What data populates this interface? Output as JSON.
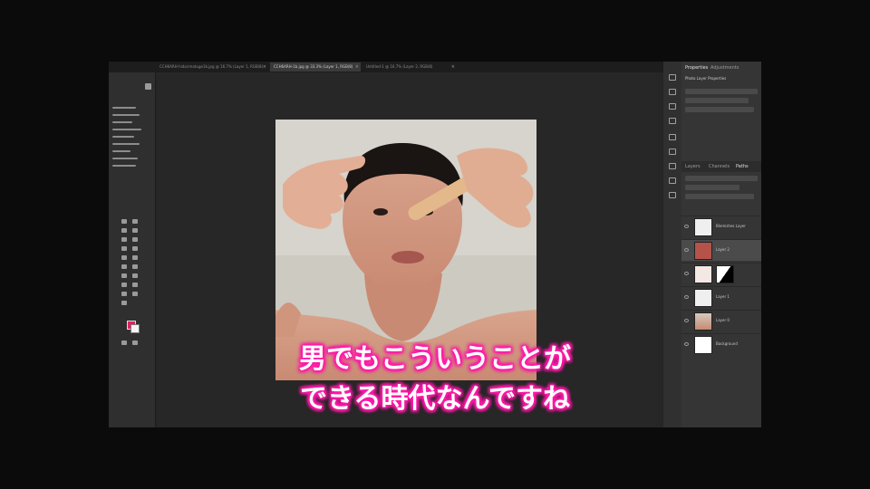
{
  "tabs": [
    {
      "label": "CCH6ARH-hidarimatuge1b.jpg @ 16.7% (Layer 1, RGB/8)",
      "active": false
    },
    {
      "label": "CCH6ARH-1b.jpg @ 33.3% (Layer 1, RGB/8)",
      "active": true
    },
    {
      "label": "Untitled-1 @ 16.7% (Layer 2, RGB/8)",
      "active": false
    }
  ],
  "tools": {
    "foreground_color": "#e2215f",
    "background_color": "#f4f4f4"
  },
  "panels": {
    "top_tabs": [
      "Properties",
      "Adjustments"
    ],
    "properties_header": "Photo Layer Properties",
    "layer_tabs": [
      "Layers",
      "Channels",
      "Paths"
    ],
    "layers": [
      {
        "name": "Blemishes Layer",
        "selected": false,
        "has_mask": false
      },
      {
        "name": "Layer 2",
        "selected": true,
        "has_mask": false
      },
      {
        "name": "",
        "selected": false,
        "has_mask": true
      },
      {
        "name": "Layer 1",
        "selected": false,
        "has_mask": false
      },
      {
        "name": "Layer 0",
        "selected": false,
        "has_mask": false
      },
      {
        "name": "Background",
        "selected": false,
        "has_mask": false
      }
    ]
  },
  "subtitles": {
    "line1": "男でもこういうことが",
    "line2": "できる時代なんですね",
    "glow_color": "#ff1aa8"
  }
}
